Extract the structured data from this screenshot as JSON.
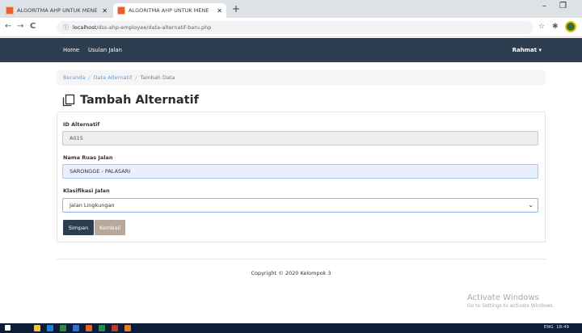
{
  "browser": {
    "tabs": [
      {
        "title": "ALGORITMA AHP UNTUK MENE",
        "active": false
      },
      {
        "title": "ALGORITMA AHP UNTUK MENE",
        "active": true
      }
    ],
    "new_tab": "+",
    "window_controls": {
      "minimize": "–",
      "maximize": "❐"
    },
    "nav": {
      "back": "←",
      "forward": "→",
      "reload": "C"
    },
    "url": {
      "host": "localhost",
      "path": "/dss-ahp-employee/data-alternatif-baru.php"
    }
  },
  "navbar": {
    "items": [
      "Home",
      "Usulan Jalan"
    ],
    "user": "Rahmat ▾"
  },
  "breadcrumb": {
    "items": [
      "Beranda",
      "Data Alternatif",
      "Tambah Data"
    ],
    "separator": "/"
  },
  "page": {
    "title": "Tambah Alternatif"
  },
  "form": {
    "id_label": "ID Alternatif",
    "id_value": "A015",
    "name_label": "Nama Ruas Jalan",
    "name_value": "SARONGGE - PALASARI",
    "class_label": "Klasifikasi Jalan",
    "class_value": "Jalan Lingkungan",
    "save_label": "Simpan",
    "back_label": "Kembali"
  },
  "footer": {
    "copyright": "Copyright © 2020 Kelompok 3"
  },
  "watermark": {
    "title": "Activate Windows",
    "subtitle": "Go to Settings to activate Windows."
  },
  "taskbar": {
    "language": "ENG",
    "time": "18:49"
  },
  "colors": {
    "navbar": "#2c3e50",
    "link": "#5b9bd5",
    "button_back": "#b8a89c"
  }
}
